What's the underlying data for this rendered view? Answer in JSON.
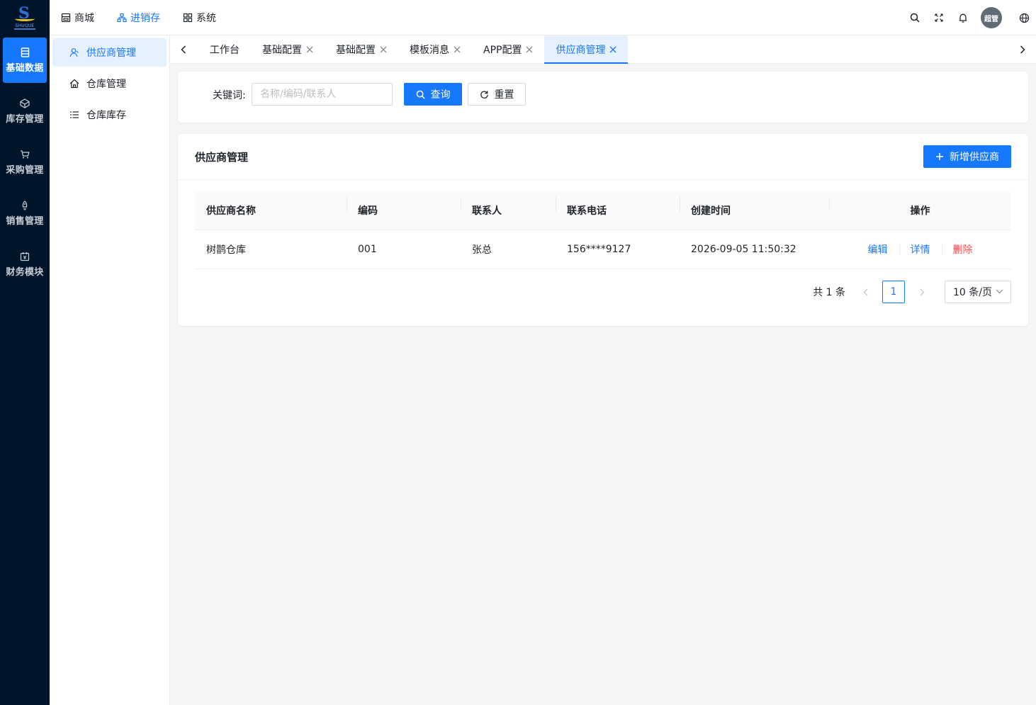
{
  "brand": {
    "logo_text": "SHUQUE"
  },
  "rail": {
    "items": [
      {
        "label": "基础数据",
        "icon": "database-icon",
        "active": true
      },
      {
        "label": "库存管理",
        "icon": "cube-icon",
        "active": false
      },
      {
        "label": "采购管理",
        "icon": "cart-icon",
        "active": false
      },
      {
        "label": "销售管理",
        "icon": "rocket-icon",
        "active": false
      },
      {
        "label": "财务模块",
        "icon": "finance-icon",
        "active": false
      }
    ]
  },
  "header": {
    "nav": [
      {
        "label": "商城",
        "icon": "shop-icon",
        "active": false
      },
      {
        "label": "进销存",
        "icon": "cluster-icon",
        "active": true
      },
      {
        "label": "系统",
        "icon": "app-icon",
        "active": false
      }
    ],
    "avatar_text": "超管",
    "icons": [
      "search-icon",
      "fullscreen-icon",
      "bell-icon",
      "globe-icon"
    ]
  },
  "subnav": {
    "items": [
      {
        "label": "供应商管理",
        "icon": "user-icon",
        "active": true
      },
      {
        "label": "仓库管理",
        "icon": "home-icon",
        "active": false
      },
      {
        "label": "仓库库存",
        "icon": "list-icon",
        "active": false
      }
    ]
  },
  "tabs": [
    {
      "label": "工作台",
      "closable": false,
      "active": false
    },
    {
      "label": "基础配置",
      "closable": true,
      "active": false
    },
    {
      "label": "基础配置",
      "closable": true,
      "active": false
    },
    {
      "label": "模板消息",
      "closable": true,
      "active": false
    },
    {
      "label": "APP配置",
      "closable": true,
      "active": false
    },
    {
      "label": "供应商管理",
      "closable": true,
      "active": true
    }
  ],
  "search": {
    "keyword_label": "关键词:",
    "keyword_placeholder": "名称/编码/联系人",
    "keyword_value": "",
    "query_label": "查询",
    "reset_label": "重置"
  },
  "list": {
    "title": "供应商管理",
    "add_label": "新增供应商",
    "columns": [
      "供应商名称",
      "编码",
      "联系人",
      "联系电话",
      "创建时间",
      "操作"
    ],
    "rows": [
      {
        "name": "树鹊仓库",
        "code": "001",
        "contact": "张总",
        "phone": "156****9127",
        "created": "2026-09-05 11:50:32"
      }
    ],
    "actions": {
      "edit": "编辑",
      "detail": "详情",
      "delete": "删除"
    }
  },
  "pagination": {
    "total_text": "共 1 条",
    "current_page": "1",
    "page_size": "10 条/页"
  },
  "colors": {
    "primary": "#1677ff",
    "danger": "#ff4d4f",
    "rail_bg": "#001529",
    "active_bg": "#e6f1ff"
  }
}
